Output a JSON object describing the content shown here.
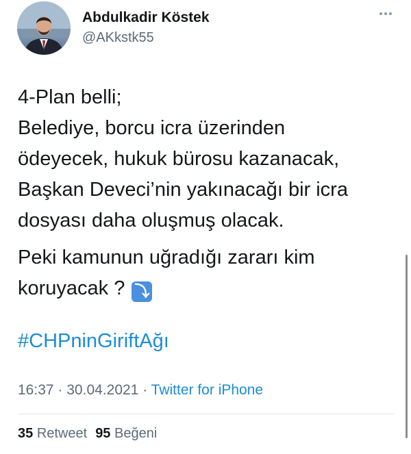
{
  "author": {
    "name": "Abdulkadir Köstek",
    "handle": "@AKkstk55"
  },
  "tweet": {
    "lines_p1": [
      "4-Plan belli;",
      "Belediye, borcu icra üzerinden",
      "ödeyecek, hukuk bürosu kazanacak,",
      "Başkan Deveci’nin yakınacağı bir icra",
      "dosyası daha oluşmuş olacak."
    ],
    "lines_p2": [
      "Peki kamunun uğradığı zararı kim",
      "koruyacak ?"
    ],
    "emoji": "⤵",
    "hashtag": "#CHPninGiriftAğı"
  },
  "meta": {
    "time": "16:37",
    "separator": "·",
    "date": "30.04.2021",
    "source": "Twitter for iPhone"
  },
  "stats": {
    "retweets_count": "35",
    "retweets_label": "Retweet",
    "likes_count": "95",
    "likes_label": "Beğeni"
  },
  "icons": {
    "more": "more-options-icon",
    "emoji": "arrow-curving-down-icon"
  }
}
